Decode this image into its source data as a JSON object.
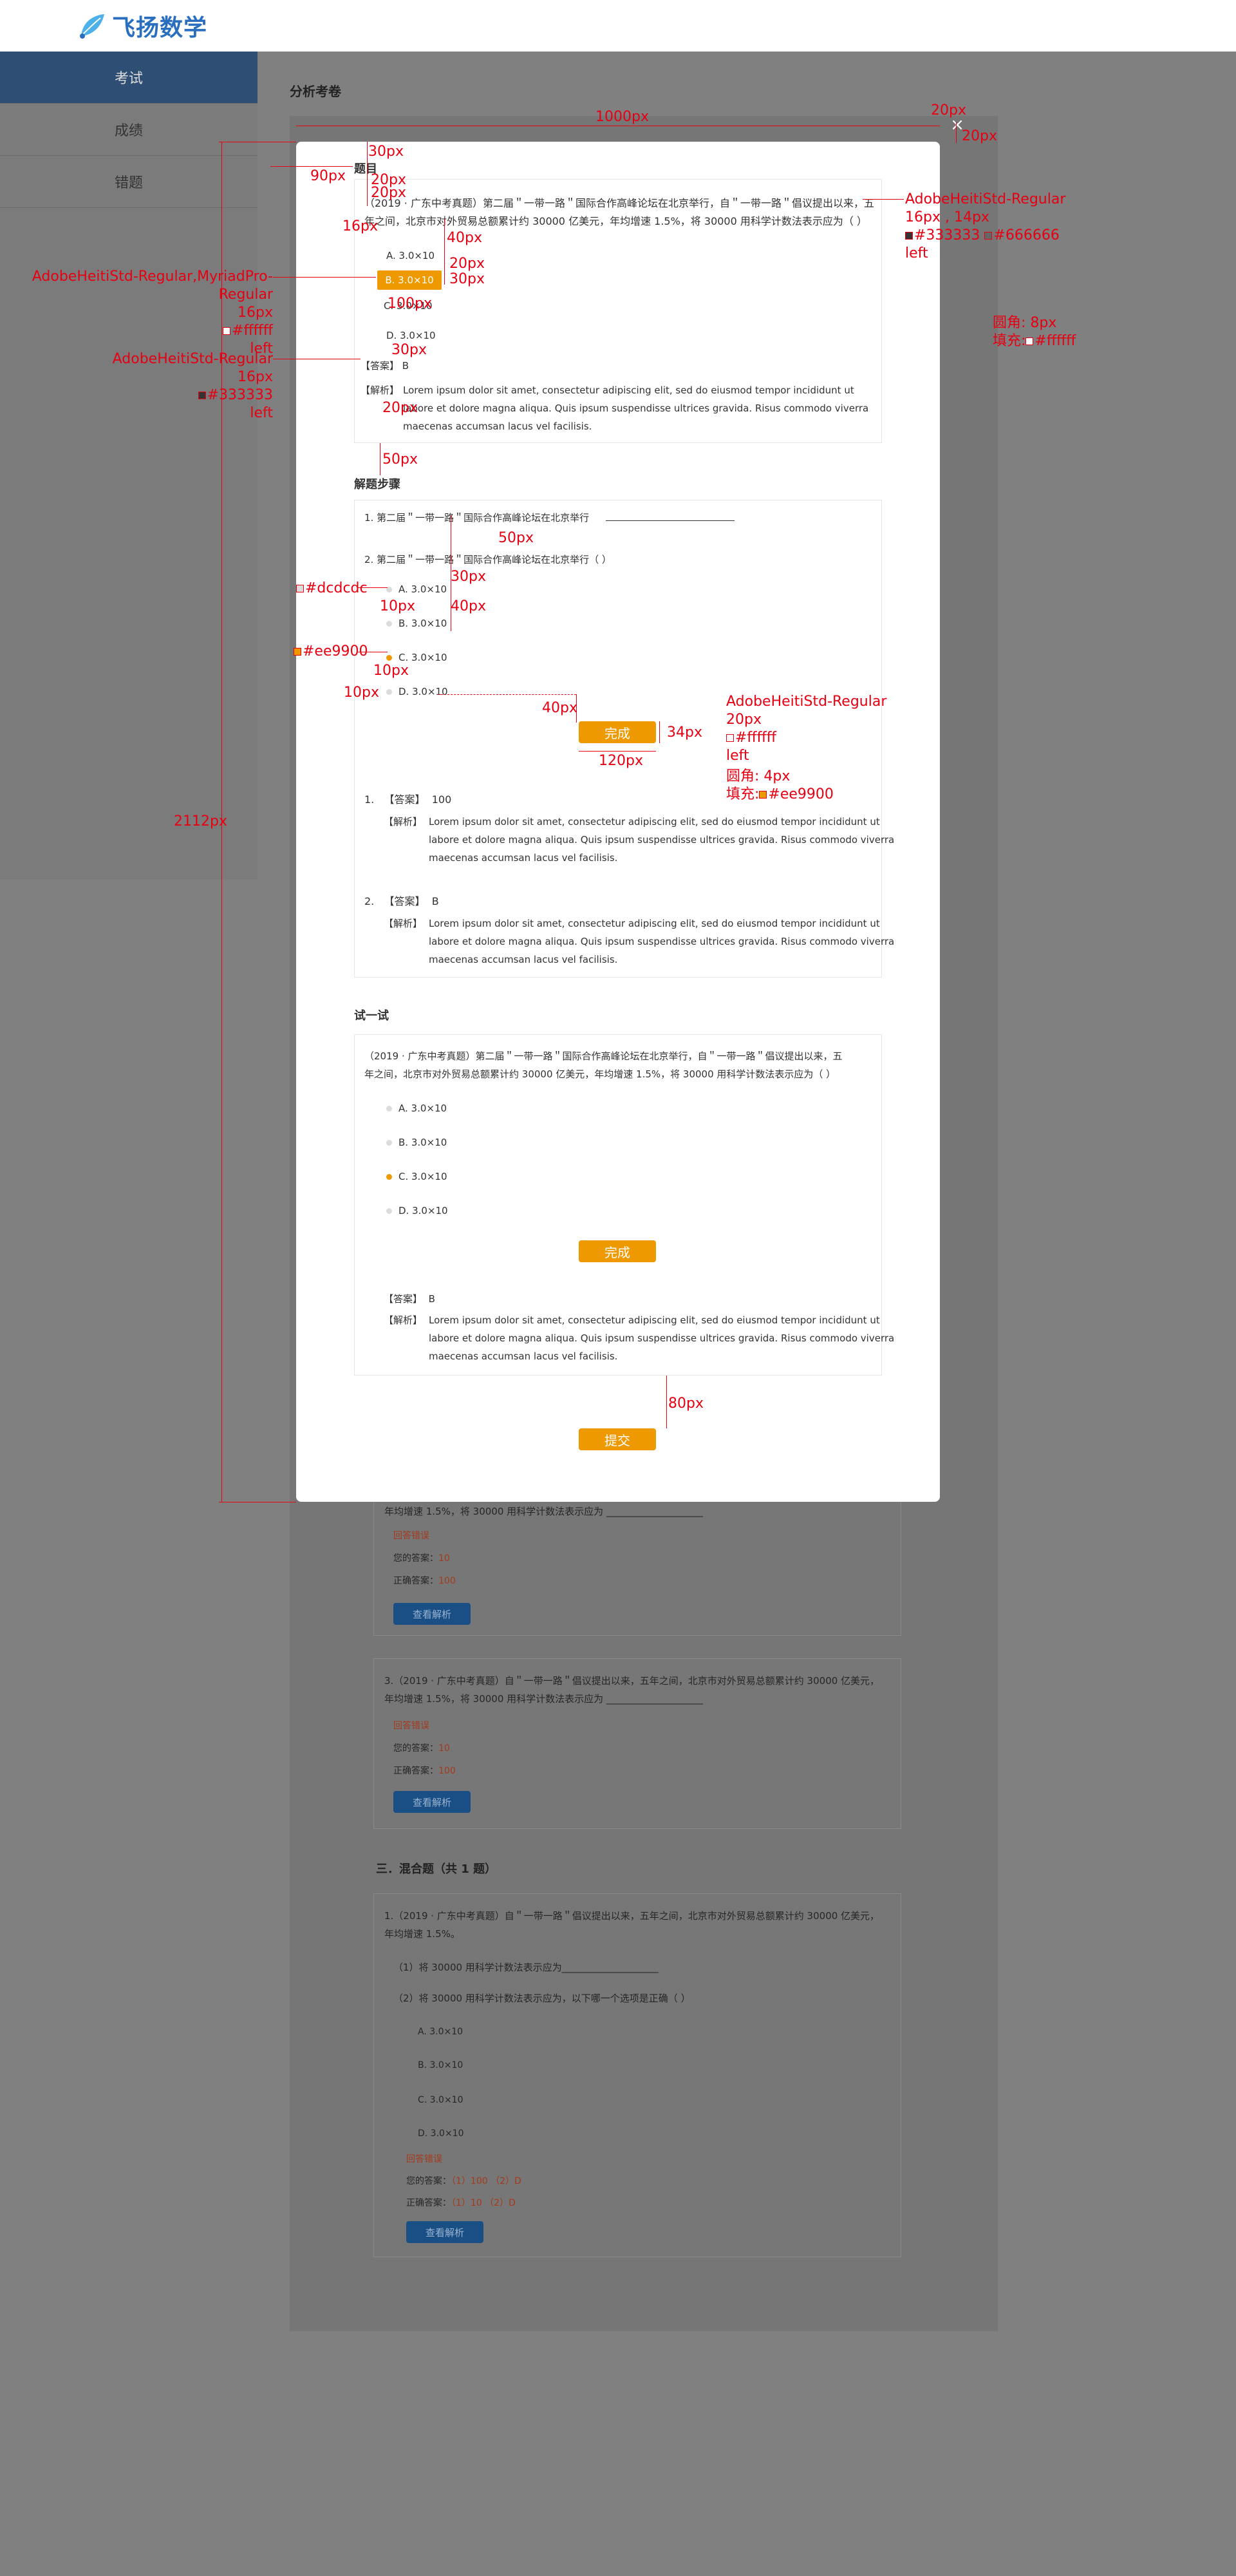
{
  "header": {
    "logo_text": "飞扬数学"
  },
  "sidebar": {
    "items": [
      {
        "label": "考试"
      },
      {
        "label": "成绩"
      },
      {
        "label": "错题"
      }
    ]
  },
  "page": {
    "title": "分析考卷"
  },
  "modal": {
    "close_symbol": "×",
    "question_section": {
      "title": "题目",
      "question_line1": "（2019 · 广东中考真题）第二届＂一带一路＂国际合作高峰论坛在北京举行，自＂一带一路＂倡议提出以来，五",
      "question_line2": "年之间，北京市对外贸易总额累计约 30000 亿美元，年均增速 1.5%，将 30000 用科学计数法表示应为（   ）",
      "options": [
        "A.  3.0×10",
        "B.  3.0×10",
        "C.  3.0×10",
        "D.  3.0×10"
      ],
      "answer_label": "【答案】",
      "answer_value": "B",
      "analysis_label": "【解析】",
      "analysis_line1": "Lorem ipsum dolor sit amet, consectetur adipiscing elit, sed do eiusmod tempor incididunt ut",
      "analysis_line2": "labore et dolore magna aliqua. Quis ipsum suspendisse ultrices gravida. Risus commodo viverra",
      "analysis_line3": "maecenas accumsan lacus vel facilisis."
    },
    "steps_section": {
      "title": "解题步骤",
      "step1": "1. 第二届＂一带一路＂国际合作高峰论坛在北京举行",
      "step2": "2. 第二届＂一带一路＂国际合作高峰论坛在北京举行（   ）",
      "options": [
        "A.  3.0×10",
        "B.  3.0×10",
        "C.  3.0×10",
        "D.  3.0×10"
      ],
      "done_button": "完成",
      "answers": [
        {
          "num": "1.",
          "answer_label": "【答案】",
          "answer_value": "100",
          "analysis_label": "【解析】"
        },
        {
          "num": "2.",
          "answer_label": "【答案】",
          "answer_value": "B",
          "analysis_label": "【解析】"
        }
      ],
      "analysis_line1": "Lorem ipsum dolor sit amet, consectetur adipiscing elit, sed do eiusmod tempor incididunt ut",
      "analysis_line2": "labore et dolore magna aliqua. Quis ipsum suspendisse ultrices gravida. Risus commodo viverra",
      "analysis_line3": "maecenas accumsan lacus vel facilisis."
    },
    "try_section": {
      "title": "试一试",
      "question_line1": "（2019 · 广东中考真题）第二届＂一带一路＂国际合作高峰论坛在北京举行，自＂一带一路＂倡议提出以来，五",
      "question_line2": "年之间，北京市对外贸易总额累计约 30000 亿美元，年均增速 1.5%，将 30000 用科学计数法表示应为（   ）",
      "options": [
        "A.  3.0×10",
        "B.  3.0×10",
        "C.  3.0×10",
        "D.  3.0×10"
      ],
      "done_button": "完成",
      "answer_label": "【答案】",
      "answer_value": "B",
      "analysis_label": "【解析】",
      "analysis_line1": "Lorem ipsum dolor sit amet, consectetur adipiscing elit, sed do eiusmod tempor incididunt ut",
      "analysis_line2": "labore et dolore magna aliqua. Quis ipsum suspendisse ultrices gravida. Risus commodo viverra",
      "analysis_line3": "maecenas accumsan lacus vel facilisis."
    },
    "submit_button": "提交"
  },
  "background": {
    "card1_line": "年均增速 1.5%，将 30000 用科学计数法表示应为 ____________________",
    "wrong_label": "回答错误",
    "your_answer_label": "您的答案：",
    "your_answer_value": "10",
    "correct_answer_label": "正确答案：",
    "correct_answer_value": "100",
    "view_button": "查看解析",
    "card2_line1": "3.（2019 · 广东中考真题）自＂一带一路＂倡议提出以来，五年之间，北京市对外贸易总额累计约 30000 亿美元，",
    "card2_line2": "年均增速 1.5%，将 30000 用科学计数法表示应为 ____________________",
    "section3_title": "三．混合题（共 1 题）",
    "card3_line1": "1.（2019 · 广东中考真题）自＂一带一路＂倡议提出以来，五年之间，北京市对外贸易总额累计约 30000 亿美元，",
    "card3_line2": "年均增速 1.5%。",
    "card3_sub1": "（1）将 30000 用科学计数法表示应为____________________",
    "card3_sub2": "（2）将 30000 用科学计数法表示应为，以下哪一个选项是正确（   ）",
    "card3_options": [
      "A.  3.0×10",
      "B.  3.0×10",
      "C.  3.0×10",
      "D.  3.0×10"
    ],
    "card3_your_answer": "（1）100          （2）D",
    "card3_correct_answer": "（1）10           （2）D"
  },
  "annotations": {
    "a_30px": "30px",
    "a_20px": "20px",
    "a_90px": "90px",
    "a_16px": "16px",
    "a_1000px": "1000px",
    "a_40px": "40px",
    "a_100px": "100px",
    "a_50px": "50px",
    "a_10px": "10px",
    "a_120px": "120px",
    "a_34px": "34px",
    "a_80px": "80px",
    "a_2112px": "2112px",
    "font_right_1": "AdobeHeitiStd-Regular",
    "font_right_2": "16px , 14px",
    "font_right_3": "#333333",
    "font_right_3b": "#666666",
    "font_right_4": "left",
    "font_left_1": "AdobeHeitiStd-Regular,MyriadPro-Regular",
    "font_left_2": "16px",
    "font_left_3": "#ffffff",
    "font_left_4": "left",
    "font_left2_1": "AdobeHeitiStd-Regular",
    "font_left2_2": "16px",
    "font_left2_3": "#333333",
    "font_left2_4": "left",
    "radius_1": "圆角: 8px",
    "radius_2": "填充:",
    "radius_2b": "#ffffff",
    "dot_gray": "#dcdcdc",
    "dot_orange": "#ee9900",
    "btn_font_1": "AdobeHeitiStd-Regular",
    "btn_font_2": "20px",
    "btn_font_3": "#ffffff",
    "btn_font_4": "left",
    "btn_radius_1": "圆角: 4px",
    "btn_radius_2": "填充:",
    "btn_radius_2b": "#ee9900"
  }
}
